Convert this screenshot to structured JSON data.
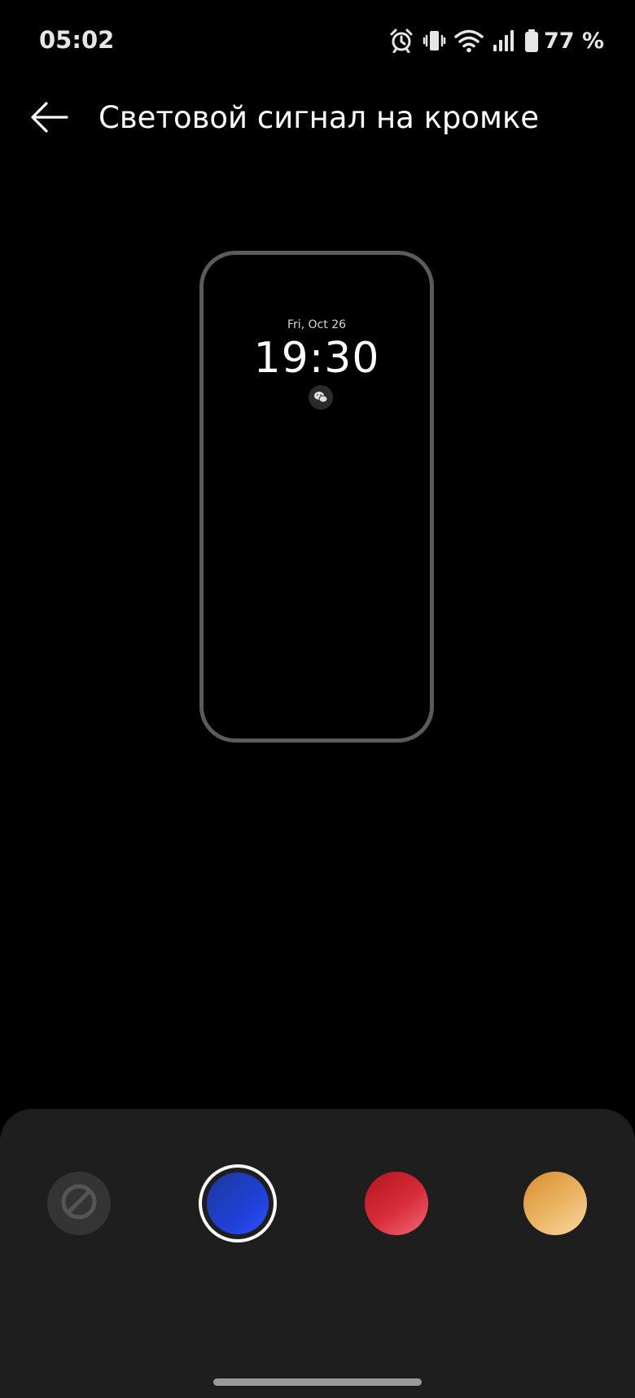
{
  "status_bar": {
    "time": "05:02",
    "battery_text": "77 %",
    "icons": [
      "alarm-icon",
      "vibrate-icon",
      "wifi-icon",
      "signal-icon",
      "battery-icon"
    ]
  },
  "header": {
    "title": "Световой сигнал на кромке",
    "back_icon": "arrow-left-icon"
  },
  "preview": {
    "date": "Fri, Oct 26",
    "time": "19:30",
    "notification_icon": "wechat-icon"
  },
  "color_options": [
    {
      "name": "none",
      "icon": "block-icon",
      "selected": false
    },
    {
      "name": "blue",
      "color": "#1f3fd6",
      "selected": true
    },
    {
      "name": "red",
      "color": "#d92d3b",
      "selected": false
    },
    {
      "name": "gold",
      "color": "#ebb565",
      "selected": false
    }
  ],
  "colors": {
    "background": "#000000",
    "panel": "#1e1e1e",
    "preview_border": "#5b5b5b"
  }
}
